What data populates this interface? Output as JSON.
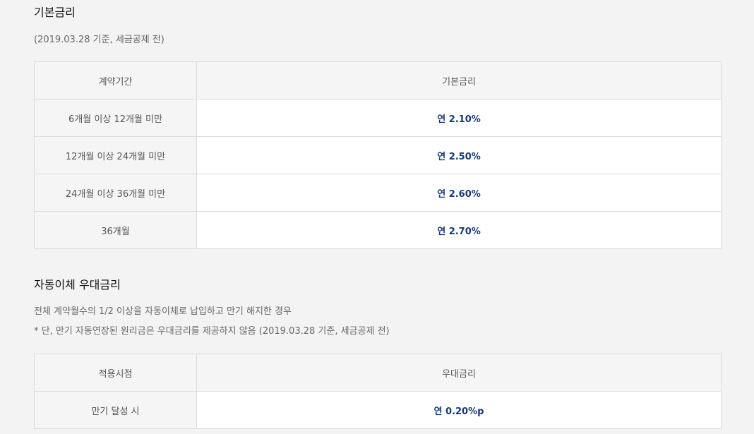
{
  "base": {
    "title": "기본금리",
    "note": "(2019.03.28 기준, 세금공제 전)",
    "headers": [
      "계약기간",
      "기본금리"
    ],
    "rows": [
      {
        "period": "6개월 이상 12개월 미만",
        "rate": "연 2.10%"
      },
      {
        "period": "12개월 이상 24개월 미만",
        "rate": "연 2.50%"
      },
      {
        "period": "24개월 이상 36개월 미만",
        "rate": "연 2.60%"
      },
      {
        "period": "36개월",
        "rate": "연 2.70%"
      }
    ]
  },
  "auto": {
    "title": "자동이체 우대금리",
    "note1": "전체 계약월수의 1/2 이상을 자동이체로 납입하고 만기 해지한 경우",
    "note2": "* 단, 만기 자동연장된 원리금은 우대금리를 제공하지 않음 (2019.03.28 기준, 세금공제 전)",
    "headers": [
      "적용시점",
      "우대금리"
    ],
    "rows": [
      {
        "period": "만기 달성 시",
        "rate": "연 0.20%p"
      }
    ]
  },
  "colors": {
    "background": "#f3f3f3",
    "rate_text": "#173a78",
    "border": "#dcdcdc"
  }
}
